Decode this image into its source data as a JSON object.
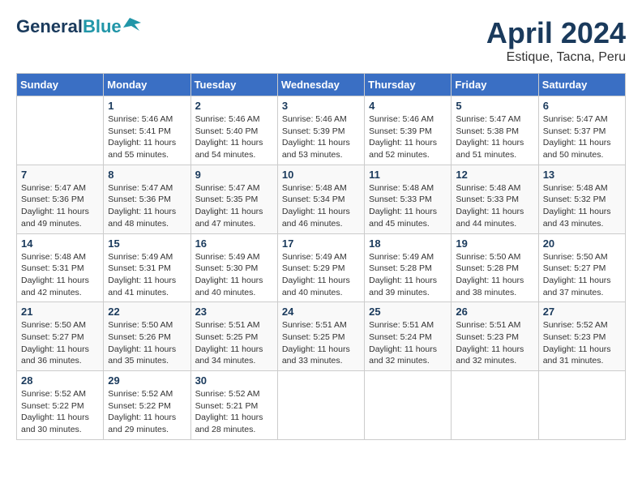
{
  "header": {
    "logo_line1": "General",
    "logo_line2": "Blue",
    "title": "April 2024",
    "location": "Estique, Tacna, Peru"
  },
  "columns": [
    "Sunday",
    "Monday",
    "Tuesday",
    "Wednesday",
    "Thursday",
    "Friday",
    "Saturday"
  ],
  "weeks": [
    [
      {
        "day": "",
        "sunrise": "",
        "sunset": "",
        "daylight": ""
      },
      {
        "day": "1",
        "sunrise": "Sunrise: 5:46 AM",
        "sunset": "Sunset: 5:41 PM",
        "daylight": "Daylight: 11 hours and 55 minutes."
      },
      {
        "day": "2",
        "sunrise": "Sunrise: 5:46 AM",
        "sunset": "Sunset: 5:40 PM",
        "daylight": "Daylight: 11 hours and 54 minutes."
      },
      {
        "day": "3",
        "sunrise": "Sunrise: 5:46 AM",
        "sunset": "Sunset: 5:39 PM",
        "daylight": "Daylight: 11 hours and 53 minutes."
      },
      {
        "day": "4",
        "sunrise": "Sunrise: 5:46 AM",
        "sunset": "Sunset: 5:39 PM",
        "daylight": "Daylight: 11 hours and 52 minutes."
      },
      {
        "day": "5",
        "sunrise": "Sunrise: 5:47 AM",
        "sunset": "Sunset: 5:38 PM",
        "daylight": "Daylight: 11 hours and 51 minutes."
      },
      {
        "day": "6",
        "sunrise": "Sunrise: 5:47 AM",
        "sunset": "Sunset: 5:37 PM",
        "daylight": "Daylight: 11 hours and 50 minutes."
      }
    ],
    [
      {
        "day": "7",
        "sunrise": "Sunrise: 5:47 AM",
        "sunset": "Sunset: 5:36 PM",
        "daylight": "Daylight: 11 hours and 49 minutes."
      },
      {
        "day": "8",
        "sunrise": "Sunrise: 5:47 AM",
        "sunset": "Sunset: 5:36 PM",
        "daylight": "Daylight: 11 hours and 48 minutes."
      },
      {
        "day": "9",
        "sunrise": "Sunrise: 5:47 AM",
        "sunset": "Sunset: 5:35 PM",
        "daylight": "Daylight: 11 hours and 47 minutes."
      },
      {
        "day": "10",
        "sunrise": "Sunrise: 5:48 AM",
        "sunset": "Sunset: 5:34 PM",
        "daylight": "Daylight: 11 hours and 46 minutes."
      },
      {
        "day": "11",
        "sunrise": "Sunrise: 5:48 AM",
        "sunset": "Sunset: 5:33 PM",
        "daylight": "Daylight: 11 hours and 45 minutes."
      },
      {
        "day": "12",
        "sunrise": "Sunrise: 5:48 AM",
        "sunset": "Sunset: 5:33 PM",
        "daylight": "Daylight: 11 hours and 44 minutes."
      },
      {
        "day": "13",
        "sunrise": "Sunrise: 5:48 AM",
        "sunset": "Sunset: 5:32 PM",
        "daylight": "Daylight: 11 hours and 43 minutes."
      }
    ],
    [
      {
        "day": "14",
        "sunrise": "Sunrise: 5:48 AM",
        "sunset": "Sunset: 5:31 PM",
        "daylight": "Daylight: 11 hours and 42 minutes."
      },
      {
        "day": "15",
        "sunrise": "Sunrise: 5:49 AM",
        "sunset": "Sunset: 5:31 PM",
        "daylight": "Daylight: 11 hours and 41 minutes."
      },
      {
        "day": "16",
        "sunrise": "Sunrise: 5:49 AM",
        "sunset": "Sunset: 5:30 PM",
        "daylight": "Daylight: 11 hours and 40 minutes."
      },
      {
        "day": "17",
        "sunrise": "Sunrise: 5:49 AM",
        "sunset": "Sunset: 5:29 PM",
        "daylight": "Daylight: 11 hours and 40 minutes."
      },
      {
        "day": "18",
        "sunrise": "Sunrise: 5:49 AM",
        "sunset": "Sunset: 5:28 PM",
        "daylight": "Daylight: 11 hours and 39 minutes."
      },
      {
        "day": "19",
        "sunrise": "Sunrise: 5:50 AM",
        "sunset": "Sunset: 5:28 PM",
        "daylight": "Daylight: 11 hours and 38 minutes."
      },
      {
        "day": "20",
        "sunrise": "Sunrise: 5:50 AM",
        "sunset": "Sunset: 5:27 PM",
        "daylight": "Daylight: 11 hours and 37 minutes."
      }
    ],
    [
      {
        "day": "21",
        "sunrise": "Sunrise: 5:50 AM",
        "sunset": "Sunset: 5:27 PM",
        "daylight": "Daylight: 11 hours and 36 minutes."
      },
      {
        "day": "22",
        "sunrise": "Sunrise: 5:50 AM",
        "sunset": "Sunset: 5:26 PM",
        "daylight": "Daylight: 11 hours and 35 minutes."
      },
      {
        "day": "23",
        "sunrise": "Sunrise: 5:51 AM",
        "sunset": "Sunset: 5:25 PM",
        "daylight": "Daylight: 11 hours and 34 minutes."
      },
      {
        "day": "24",
        "sunrise": "Sunrise: 5:51 AM",
        "sunset": "Sunset: 5:25 PM",
        "daylight": "Daylight: 11 hours and 33 minutes."
      },
      {
        "day": "25",
        "sunrise": "Sunrise: 5:51 AM",
        "sunset": "Sunset: 5:24 PM",
        "daylight": "Daylight: 11 hours and 32 minutes."
      },
      {
        "day": "26",
        "sunrise": "Sunrise: 5:51 AM",
        "sunset": "Sunset: 5:23 PM",
        "daylight": "Daylight: 11 hours and 32 minutes."
      },
      {
        "day": "27",
        "sunrise": "Sunrise: 5:52 AM",
        "sunset": "Sunset: 5:23 PM",
        "daylight": "Daylight: 11 hours and 31 minutes."
      }
    ],
    [
      {
        "day": "28",
        "sunrise": "Sunrise: 5:52 AM",
        "sunset": "Sunset: 5:22 PM",
        "daylight": "Daylight: 11 hours and 30 minutes."
      },
      {
        "day": "29",
        "sunrise": "Sunrise: 5:52 AM",
        "sunset": "Sunset: 5:22 PM",
        "daylight": "Daylight: 11 hours and 29 minutes."
      },
      {
        "day": "30",
        "sunrise": "Sunrise: 5:52 AM",
        "sunset": "Sunset: 5:21 PM",
        "daylight": "Daylight: 11 hours and 28 minutes."
      },
      {
        "day": "",
        "sunrise": "",
        "sunset": "",
        "daylight": ""
      },
      {
        "day": "",
        "sunrise": "",
        "sunset": "",
        "daylight": ""
      },
      {
        "day": "",
        "sunrise": "",
        "sunset": "",
        "daylight": ""
      },
      {
        "day": "",
        "sunrise": "",
        "sunset": "",
        "daylight": ""
      }
    ]
  ]
}
